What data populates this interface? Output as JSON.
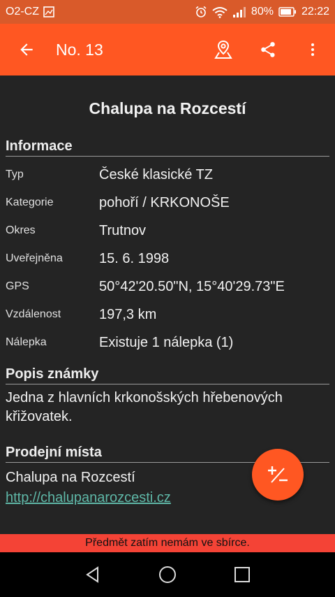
{
  "status_bar": {
    "carrier": "O2-CZ",
    "battery": "80%",
    "time": "22:22"
  },
  "app_bar": {
    "title": "No. 13",
    "icons": [
      "back-arrow-icon",
      "map-pin-icon",
      "share-icon",
      "more-vert-icon"
    ]
  },
  "stamp": {
    "name": "Chalupa na Rozcestí"
  },
  "info": {
    "title": "Informace",
    "rows": [
      {
        "label": "Typ",
        "value": "České klasické TZ"
      },
      {
        "label": "Kategorie",
        "value": "pohoří / KRKONOŠE"
      },
      {
        "label": "Okres",
        "value": "Trutnov"
      },
      {
        "label": "Uveřejněna",
        "value": "15. 6. 1998"
      },
      {
        "label": "GPS",
        "value": "50°42'20.50\"N, 15°40'29.73\"E"
      },
      {
        "label": "Vzdálenost",
        "value": "197,3 km"
      },
      {
        "label": "Nálepka",
        "value": "Existuje 1 nálepka (1)"
      }
    ]
  },
  "popis": {
    "title": "Popis známky",
    "text": "Jedna z hlavních krkonošských hřebenových křižovatek."
  },
  "prodej": {
    "title": "Prodejní místa",
    "name": "Chalupa na Rozcestí",
    "url": "http://chalupanarozcesti.cz"
  },
  "banner": {
    "text": "Předmět zatím nemám ve sbírce."
  },
  "colors": {
    "accent": "#ff5722",
    "status_bar": "#d95a2a",
    "banner": "#f44336",
    "background": "#242424",
    "link": "#5fb8a8"
  }
}
